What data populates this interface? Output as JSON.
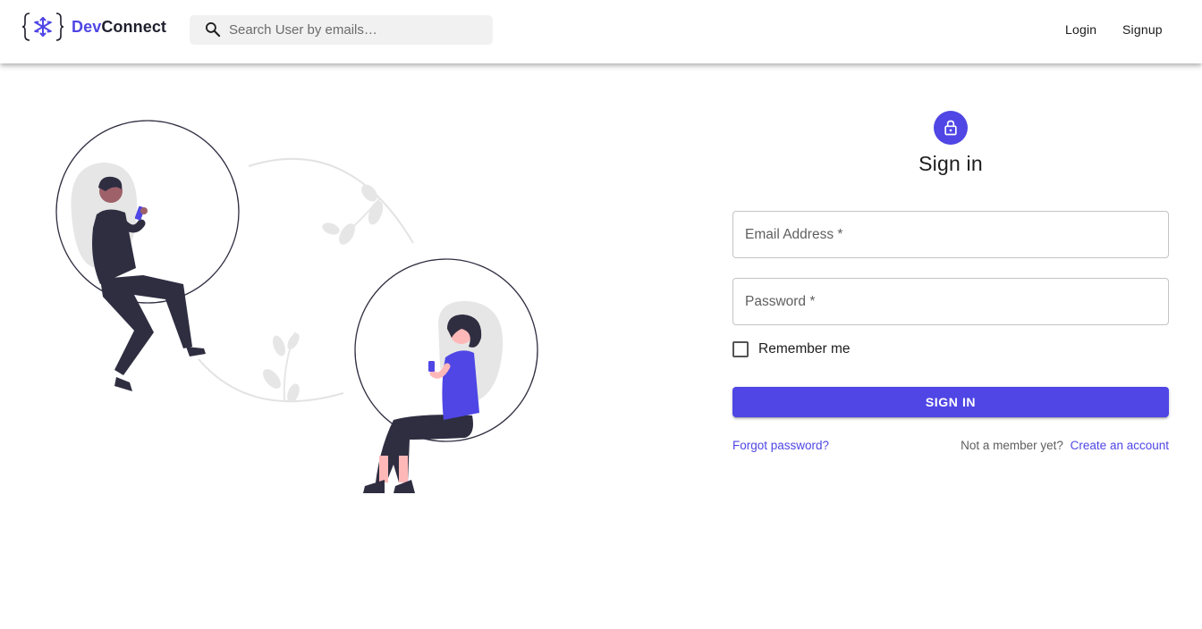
{
  "header": {
    "brand": {
      "prefix": "Dev",
      "suffix": "Connect",
      "logo_icon": "code-braces-snowflake-logo"
    },
    "search": {
      "placeholder": "Search User by emails…",
      "value": "",
      "icon": "search-icon"
    },
    "nav": {
      "login": "Login",
      "signup": "Signup"
    }
  },
  "illustration": {
    "description_icon": "people-with-phones-illustration"
  },
  "form": {
    "icon": "lock-icon",
    "title": "Sign in",
    "email_label": "Email Address *",
    "email_value": "",
    "password_label": "Password *",
    "password_value": "",
    "remember_label": "Remember me",
    "remember_checked": false,
    "submit_label": "SIGN IN",
    "forgot_link": "Forgot password?",
    "member_text": "Not a member yet?",
    "create_link": "Create an account"
  },
  "colors": {
    "accent": "#4f46e5",
    "dark_figure": "#2f2e41",
    "skin_dark": "#9e616a",
    "skin_light": "#ffb8b8",
    "leaf": "#e6e6e6"
  }
}
